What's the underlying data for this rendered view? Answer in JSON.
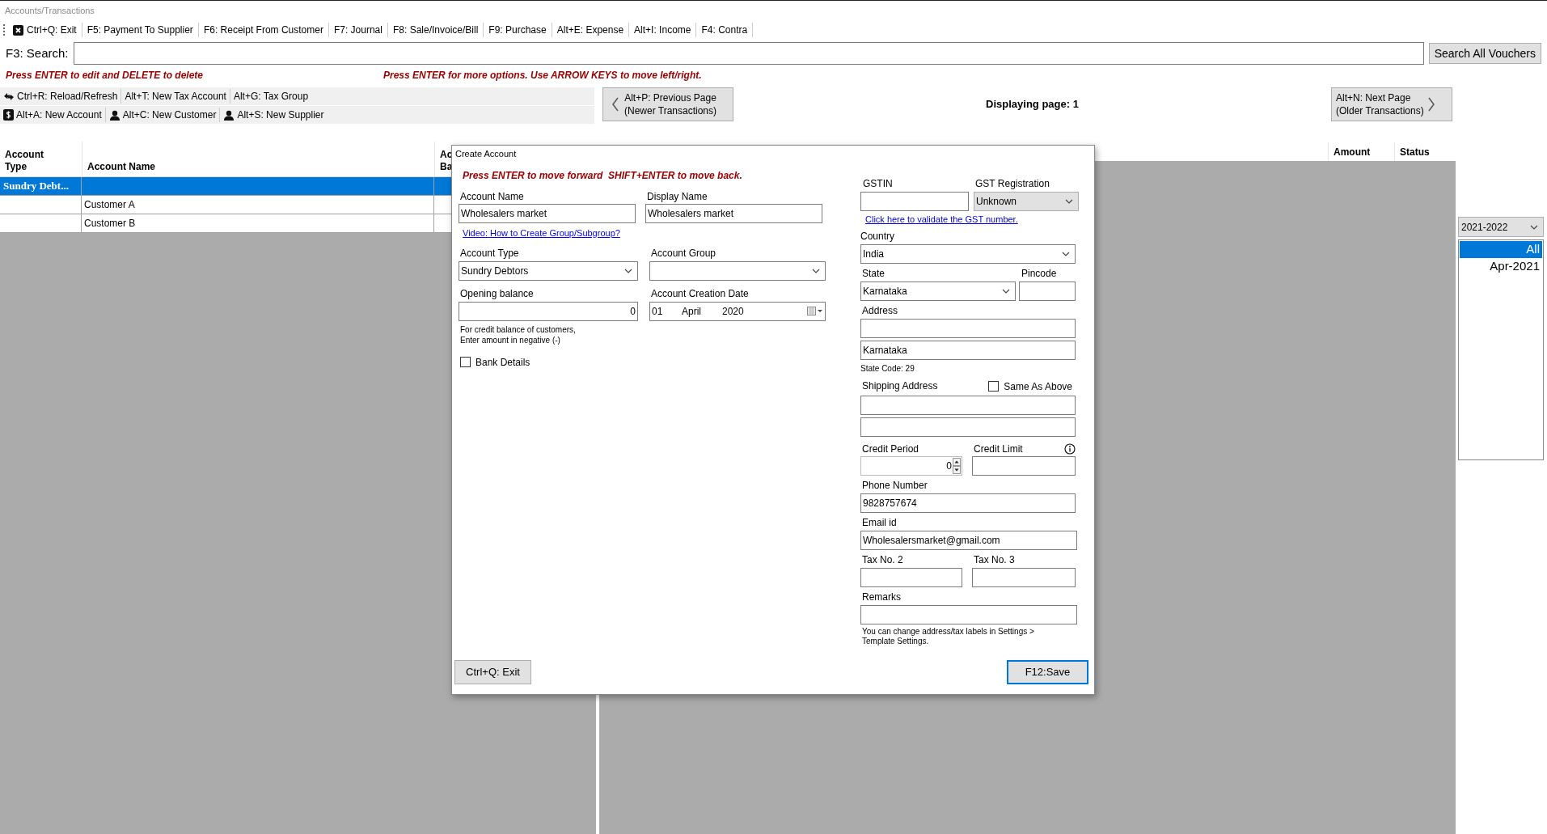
{
  "breadcrumb": "Accounts/Transactions",
  "toolbar": [
    {
      "label": "Ctrl+Q: Exit",
      "kind": "close"
    },
    {
      "label": "F5: Payment To Supplier"
    },
    {
      "label": "F6: Receipt From Customer"
    },
    {
      "label": "F7: Journal"
    },
    {
      "label": "F8: Sale/Invoice/Bill"
    },
    {
      "label": "F9: Purchase"
    },
    {
      "label": "Alt+E: Expense"
    },
    {
      "label": "Alt+I: Income"
    },
    {
      "label": "F4: Contra"
    }
  ],
  "search": {
    "label": "F3: Search:",
    "button": "Search All Vouchers"
  },
  "hints": [
    "Press ENTER to edit and DELETE to delete",
    "Press ENTER for more options. Use ARROW KEYS to move left/right."
  ],
  "actions": [
    [
      {
        "label": "Ctrl+R: Reload/Refresh",
        "kind": "refresh"
      },
      {
        "label": "Alt+T: New Tax Account"
      },
      {
        "label": "Alt+G: Tax Group"
      }
    ],
    [
      {
        "label": "Alt+A: New Account",
        "kind": "money"
      },
      {
        "label": "Alt+C: New Customer",
        "kind": "person"
      },
      {
        "label": "Alt+S: New Supplier",
        "kind": "person"
      }
    ]
  ],
  "pager": {
    "previous": [
      "Alt+P: Previous Page",
      "(Newer Transactions)"
    ],
    "page": "Displaying page: 1",
    "next": [
      "Alt+N: Next Page",
      "(Older Transactions)"
    ]
  },
  "accounts_table": {
    "columns": [
      "Account Type",
      "Account Name",
      "Ac\nBa"
    ],
    "rows": [
      {
        "account_type": "Sundry Debt...",
        "selected": true
      },
      {
        "account_name": "Customer A",
        "selected": false
      },
      {
        "account_name": "Customer B",
        "selected": false
      }
    ]
  },
  "transactions_table": {
    "columns": [
      "Amount",
      "Status"
    ]
  },
  "period": {
    "year": "2021-2022",
    "months": [
      {
        "label": "All",
        "selected": true
      },
      {
        "label": "Apr-2021",
        "selected": false
      }
    ]
  },
  "dialog": {
    "title": "Create Account",
    "hint": "Press ENTER to move forward  SHIFT+ENTER to move back.",
    "account_name": {
      "label": "Account Name",
      "value": "Wholesalers market"
    },
    "display_name": {
      "label": "Display Name",
      "value": "Wholesalers market"
    },
    "video_link": "Video: How to Create Group/Subgroup?",
    "account_type": {
      "label": "Account Type",
      "value": "Sundry Debtors"
    },
    "account_group": {
      "label": "Account Group"
    },
    "opening_balance": {
      "label": "Opening balance",
      "value": "0"
    },
    "creation_date": {
      "label": "Account Creation Date",
      "day": "01",
      "month": "April",
      "year": "2020"
    },
    "balance_note": [
      "For credit balance of customers,",
      "Enter amount in negative (-)"
    ],
    "bank_details": {
      "label": "Bank Details",
      "checked": false
    },
    "gstin": {
      "label": "GSTIN"
    },
    "gst_registration": {
      "label": "GST Registration",
      "value": "Unknown"
    },
    "gst_link": "Click here to validate the GST number.",
    "country": {
      "label": "Country",
      "value": "India"
    },
    "state": {
      "label": "State",
      "value": "Karnataka"
    },
    "pincode": {
      "label": "Pincode"
    },
    "address": {
      "label": "Address",
      "line_2": "Karnataka"
    },
    "state_code": "State Code: 29",
    "shipping_address": {
      "label": "Shipping Address"
    },
    "same_as_above": {
      "label": "Same As Above",
      "checked": false
    },
    "credit_period": {
      "label": "Credit Period",
      "value": "0"
    },
    "credit_limit": {
      "label": "Credit Limit"
    },
    "phone": {
      "label": "Phone Number",
      "value": "9828757674"
    },
    "email": {
      "label": "Email id",
      "value": "Wholesalersmarket@gmail.com"
    },
    "tax_no_2": {
      "label": "Tax No. 2"
    },
    "tax_no_3": {
      "label": "Tax No. 3"
    },
    "remarks": {
      "label": "Remarks"
    },
    "label_note": "You can change address/tax labels in Settings > Template Settings.",
    "buttons": {
      "exit": "Ctrl+Q: Exit",
      "save": "F12:Save"
    }
  }
}
